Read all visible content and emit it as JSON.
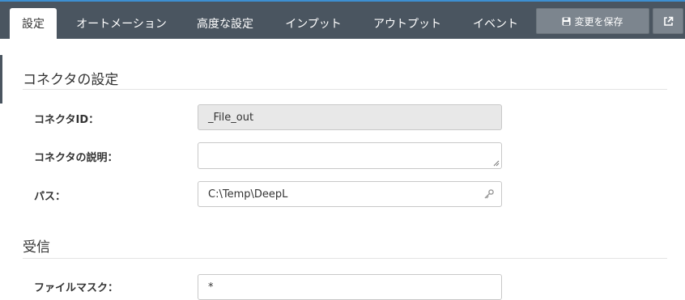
{
  "tabs": [
    {
      "label": "設定",
      "active": true
    },
    {
      "label": "オートメーション",
      "active": false
    },
    {
      "label": "高度な設定",
      "active": false
    },
    {
      "label": "インプット",
      "active": false
    },
    {
      "label": "アウトプット",
      "active": false
    },
    {
      "label": "イベント",
      "active": false
    }
  ],
  "toolbar": {
    "save_label": "変更を保存",
    "save_icon": "floppy-disk-icon",
    "external_icon": "external-link-icon"
  },
  "section_connector": {
    "title": "コネクタの設定",
    "fields": {
      "id_label": "コネクタID：",
      "id_value": "_File_out",
      "desc_label": "コネクタの説明：",
      "desc_value": "",
      "path_label": "パス：",
      "path_value": "C:\\Temp\\DeepL",
      "path_icon": "key-icon"
    }
  },
  "section_receive": {
    "title": "受信",
    "filemask_label": "ファイルマスク：",
    "filemask_value": "*"
  },
  "colors": {
    "topbar": "#4a5560",
    "accent": "#3d8fd1",
    "button": "#7c858e"
  }
}
